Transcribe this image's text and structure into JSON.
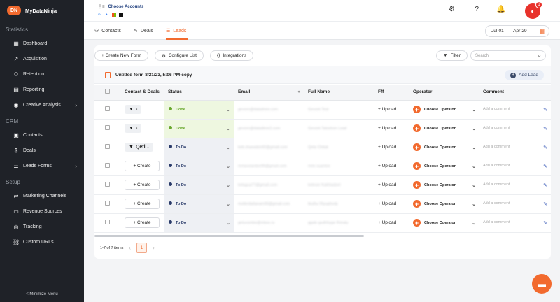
{
  "app": {
    "name": "MyDataNinja",
    "logo_mark": "DN"
  },
  "sidebar": {
    "sections": [
      {
        "title": "Statistics",
        "items": [
          {
            "label": "Dashboard",
            "icon": "dashboard-icon",
            "glyph": "▦"
          },
          {
            "label": "Acquisition",
            "icon": "trend-icon",
            "glyph": "↗"
          },
          {
            "label": "Retention",
            "icon": "group-icon",
            "glyph": "⚇"
          },
          {
            "label": "Reporting",
            "icon": "report-icon",
            "glyph": "▤"
          },
          {
            "label": "Creative Analysis",
            "icon": "palette-icon",
            "glyph": "◉",
            "chevron": true
          }
        ]
      },
      {
        "title": "CRM",
        "items": [
          {
            "label": "Contacts",
            "icon": "contacts-icon",
            "glyph": "▣"
          },
          {
            "label": "Deals",
            "icon": "deals-icon",
            "glyph": "$"
          },
          {
            "label": "Leads Forms",
            "icon": "forms-icon",
            "glyph": "☰",
            "chevron": true
          }
        ]
      },
      {
        "title": "Setup",
        "items": [
          {
            "label": "Marketing Channels",
            "icon": "channels-icon",
            "glyph": "⇄"
          },
          {
            "label": "Revenue Sources",
            "icon": "revenue-icon",
            "glyph": "▭"
          },
          {
            "label": "Tracking",
            "icon": "tracking-icon",
            "glyph": "◎"
          },
          {
            "label": "Custom URLs",
            "icon": "link-icon",
            "glyph": "⛓"
          }
        ]
      }
    ],
    "minimize_label": "< Minimize Menu"
  },
  "topbar": {
    "accounts_label": "Choose Accounts",
    "notification_count": "1"
  },
  "tabs": [
    {
      "label": "Contacts",
      "glyph": "⚇",
      "icon": "contacts-tab-icon"
    },
    {
      "label": "Deals",
      "glyph": "✎",
      "icon": "deals-tab-icon"
    },
    {
      "label": "Leads",
      "glyph": "☰",
      "icon": "leads-tab-icon",
      "active": true
    }
  ],
  "date_range": {
    "start": "Jul-01",
    "separator": "-",
    "end": "Apr-29"
  },
  "toolbar": {
    "new_form": "+ Create New Form",
    "configure": "Configure List",
    "integrations": "Integrations",
    "filter": "Filter",
    "search_placeholder": "Search"
  },
  "form": {
    "title": "Untitled form 8/21/23, 5:06 PM-copy",
    "add_lead": "Add Lead"
  },
  "columns": [
    "Contact & Deals",
    "Status",
    "Email",
    "Full Name",
    "Fff",
    "Operator",
    "Comment"
  ],
  "rows": [
    {
      "contact": "-",
      "contact_type": "filter",
      "status": "Done",
      "status_type": "done",
      "email": "gevorn@datadninr.com",
      "name": "Gevork Test",
      "upload": "+ Upload",
      "operator": "Choose Operator",
      "comment": "Add a comment"
    },
    {
      "contact": "-",
      "contact_type": "filter",
      "status": "Done",
      "status_type": "done",
      "email": "gevorn@datadinnr2.com",
      "name": "Gevork Tatoshon Lead",
      "upload": "+ Upload",
      "operator": "Choose Operator",
      "comment": "Add a comment"
    },
    {
      "contact": "Qeti...",
      "contact_type": "filter",
      "status": "To Do",
      "status_type": "todo",
      "email": "keti.chaeadze92@gmail.com",
      "name": "Qeta Chituk",
      "upload": "+ Upload",
      "operator": "Choose Operator",
      "comment": "Add a comment"
    },
    {
      "contact": "+ Create",
      "contact_type": "create",
      "status": "To Do",
      "status_type": "todo",
      "email": "mmavsiardze99@gmail.com",
      "name": "mrio suardze",
      "upload": "+ Upload",
      "operator": "Choose Operator",
      "comment": "Add a comment"
    },
    {
      "contact": "+ Create",
      "contact_type": "create",
      "status": "To Do",
      "status_type": "todo",
      "email": "kelagua77@gmail.com",
      "name": "keleser Kakhiadzet",
      "upload": "+ Upload",
      "operator": "Choose Operator",
      "comment": "Add a comment"
    },
    {
      "contact": "+ Create",
      "contact_type": "create",
      "status": "To Do",
      "status_type": "todo",
      "email": "mollerdatlanam99@gmail.com",
      "name": "tkuthu Rtyuphody",
      "upload": "+ Upload",
      "operator": "Choose Operator",
      "comment": "Add a comment"
    },
    {
      "contact": "+ Create",
      "contact_type": "create",
      "status": "To Do",
      "status_type": "todo",
      "email": "getuvsmbe@mbox.ru",
      "name": "ggalo gudhhyge Rimaly",
      "upload": "+ Upload",
      "operator": "Choose Operator",
      "comment": "Add a comment"
    }
  ],
  "pagination": {
    "summary": "1-7 of 7 items",
    "current": "1"
  },
  "colors": {
    "accent": "#f26a2e",
    "sidebar_bg": "#1f2228",
    "done": "#6aa82f",
    "todo": "#2a3b6a"
  }
}
